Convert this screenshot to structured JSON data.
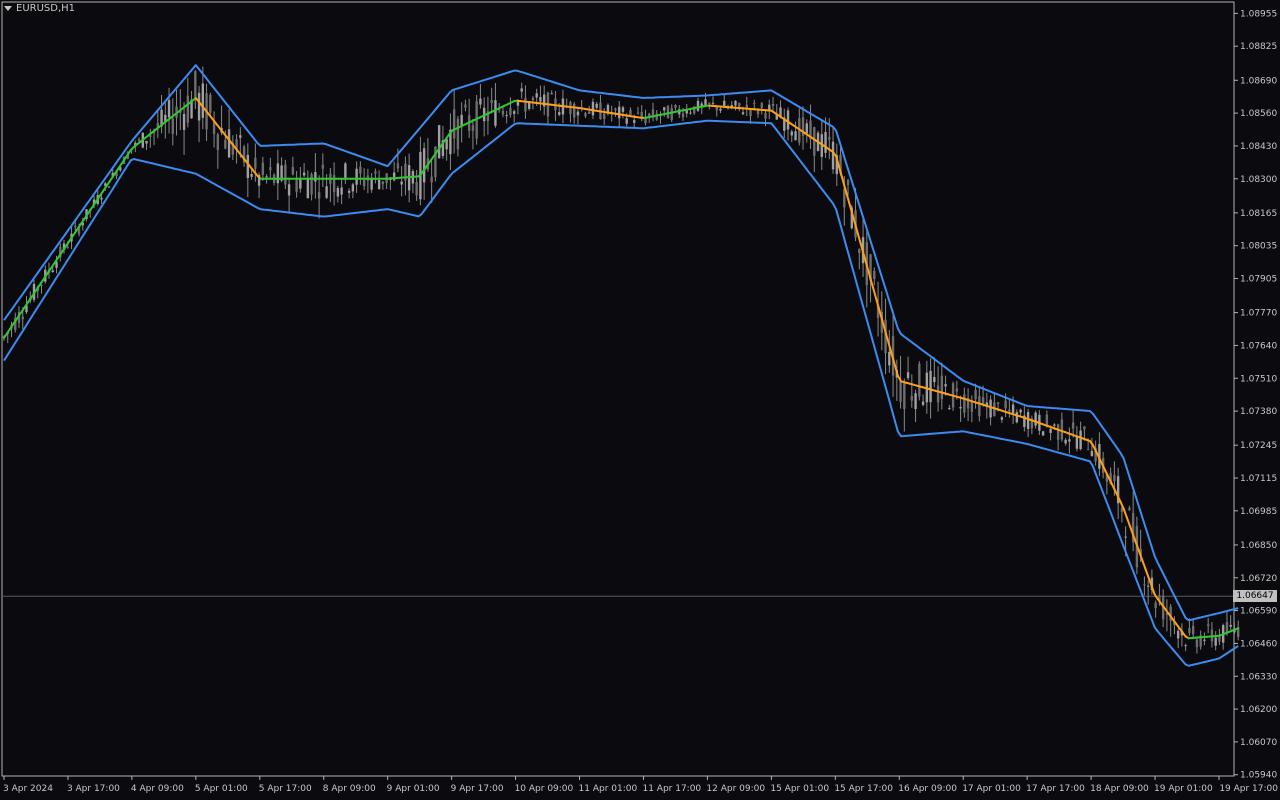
{
  "window": {
    "symbol_title": "EURUSD,H1"
  },
  "current_price_label": "1.06647",
  "colors": {
    "background": "#0a0a0f",
    "frame": "#b4b4b4",
    "axis_text": "#c8c8c8",
    "upper_band": "#3c8cf0",
    "lower_band": "#3c8cf0",
    "mid_up": "#32c832",
    "mid_down": "#ffa014",
    "candles": "#8a8a8a",
    "price_line": "#5a5a5a"
  },
  "chart_data": {
    "type": "line",
    "instrument": "EURUSD",
    "timeframe": "H1",
    "y_ticks": [
      "1.08955",
      "1.08825",
      "1.08690",
      "1.08560",
      "1.08430",
      "1.08300",
      "1.08165",
      "1.08035",
      "1.07905",
      "1.07770",
      "1.07640",
      "1.07510",
      "1.07380",
      "1.07245",
      "1.07115",
      "1.06985",
      "1.06850",
      "1.06720",
      "1.06590",
      "1.06460",
      "1.06330",
      "1.06200",
      "1.06070",
      "1.05940"
    ],
    "x_ticks": [
      "3 Apr 2024",
      "3 Apr 17:00",
      "4 Apr 09:00",
      "5 Apr 01:00",
      "5 Apr 17:00",
      "8 Apr 09:00",
      "9 Apr 01:00",
      "9 Apr 17:00",
      "10 Apr 09:00",
      "11 Apr 01:00",
      "11 Apr 17:00",
      "12 Apr 09:00",
      "15 Apr 01:00",
      "15 Apr 17:00",
      "16 Apr 09:00",
      "17 Apr 01:00",
      "17 Apr 17:00",
      "18 Apr 09:00",
      "19 Apr 01:00",
      "19 Apr 17:00"
    ],
    "ylim": [
      1.05935,
      1.09
    ],
    "current_price": 1.06647,
    "series": [
      {
        "role": "upper_band",
        "x": [
          0,
          2,
          3,
          4,
          5,
          6,
          6.5,
          7,
          8,
          9,
          10,
          11,
          12,
          13,
          14,
          15,
          16,
          17,
          17.5,
          18,
          18.5,
          19,
          19.3
        ],
        "y": [
          1.0774,
          1.0845,
          1.0875,
          1.0843,
          1.0844,
          1.0835,
          1.085,
          1.0865,
          1.0873,
          1.0865,
          1.0862,
          1.0863,
          1.0865,
          1.085,
          1.0769,
          1.075,
          1.074,
          1.0738,
          1.072,
          1.068,
          1.0655,
          1.0658,
          1.066
        ]
      },
      {
        "role": "middle_band",
        "x": [
          0,
          2,
          3,
          4,
          5,
          6,
          6.5,
          7,
          8,
          9,
          10,
          11,
          12,
          13,
          14,
          15,
          16,
          17,
          17.5,
          18,
          18.5,
          19,
          19.3
        ],
        "y": [
          1.0767,
          1.0842,
          1.0862,
          1.083,
          1.083,
          1.083,
          1.0831,
          1.0849,
          1.0861,
          1.0858,
          1.0854,
          1.0859,
          1.0857,
          1.084,
          1.075,
          1.0743,
          1.0735,
          1.0726,
          1.07,
          1.0665,
          1.0648,
          1.0649,
          1.0652
        ]
      },
      {
        "role": "lower_band",
        "x": [
          0,
          2,
          3,
          4,
          5,
          6,
          6.5,
          7,
          8,
          9,
          10,
          11,
          12,
          13,
          14,
          15,
          16,
          17,
          17.5,
          18,
          18.5,
          19,
          19.3
        ],
        "y": [
          1.0758,
          1.0838,
          1.0832,
          1.0818,
          1.0815,
          1.0818,
          1.0815,
          1.0832,
          1.0852,
          1.0851,
          1.085,
          1.0853,
          1.0852,
          1.0819,
          1.0728,
          1.073,
          1.0725,
          1.0718,
          1.0685,
          1.0652,
          1.0637,
          1.064,
          1.0645
        ]
      }
    ]
  }
}
